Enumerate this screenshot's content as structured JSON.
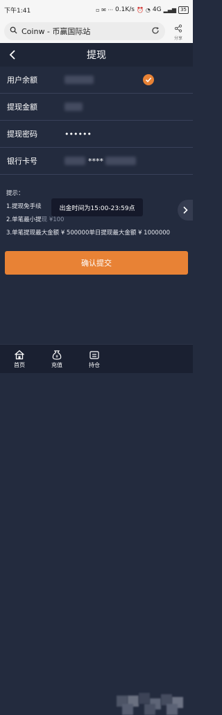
{
  "status_bar": {
    "time": "下午1:41",
    "network_speed": "0.1K/s",
    "signal": "4G",
    "battery": "35"
  },
  "browser": {
    "address": "Coinw - 币赢国际站",
    "share_label": "分享"
  },
  "header": {
    "title": "提现"
  },
  "form": {
    "balance_label": "用户余额",
    "amount_label": "提现金额",
    "password_label": "提现密码",
    "password_value": "••••••",
    "card_label": "银行卡号",
    "card_visible": "****"
  },
  "tips": {
    "heading": "提示：",
    "line1": "1.提现免手续",
    "line2": "2.单笔最小提",
    "line2_tail": "现 ¥100",
    "line3": "3.单笔提现最大金额 ¥ 500000单日提现最大金额 ¥ 1000000"
  },
  "toast": {
    "text": "出金时间为15:00-23:59点"
  },
  "confirm_button": {
    "label": "确认提交"
  },
  "tab_bar": {
    "items": [
      {
        "label": "首页",
        "icon": "home-icon"
      },
      {
        "label": "充值",
        "icon": "money-bag-icon"
      },
      {
        "label": "持仓",
        "icon": "position-icon"
      }
    ]
  },
  "colors": {
    "background": "#232b3e",
    "accent": "#e88235",
    "nav": "#1e2536"
  }
}
